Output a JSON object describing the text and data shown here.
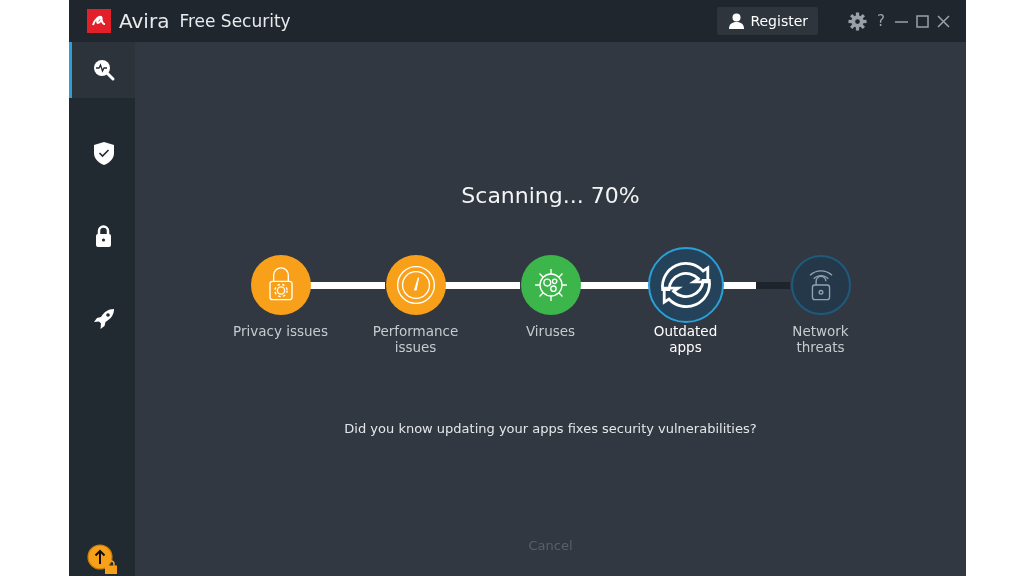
{
  "window": {
    "app_name": "Avira",
    "product": "Free Security",
    "register_button": "Register",
    "help_button": "?"
  },
  "sidebar": {
    "items": [
      {
        "selected": true
      },
      {
        "selected": false
      },
      {
        "selected": false
      },
      {
        "selected": false
      }
    ]
  },
  "scan": {
    "heading": "Scanning... 70%",
    "steps": [
      {
        "label": "Privacy issues",
        "kind": "done",
        "color": "#f9a01b"
      },
      {
        "label": "Performance issues",
        "kind": "done",
        "color": "#f9a01b"
      },
      {
        "label": "Viruses",
        "kind": "done",
        "color": "#3cb54a"
      },
      {
        "label": "Outdated apps",
        "kind": "active"
      },
      {
        "label": "Network threats",
        "kind": "pending"
      }
    ],
    "tip": "Did you know updating your apps fixes security vulnerabilities?",
    "cancel": {
      "label": "Cancel",
      "disabled": true
    }
  }
}
